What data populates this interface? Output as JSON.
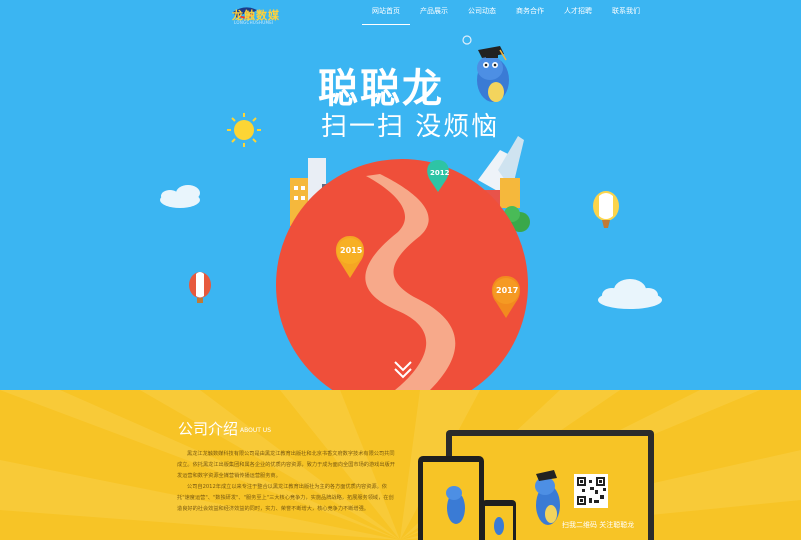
{
  "logo": {
    "name": "龙触数媒",
    "sub": "LONGCHUSHUMEI"
  },
  "nav": {
    "items": [
      {
        "label": "网站首页",
        "active": true
      },
      {
        "label": "产品展示",
        "active": false
      },
      {
        "label": "公司动态",
        "active": false
      },
      {
        "label": "商务合作",
        "active": false
      },
      {
        "label": "人才招聘",
        "active": false
      },
      {
        "label": "联系我们",
        "active": false
      }
    ]
  },
  "hero": {
    "title": "聪聪龙",
    "subtitle": "扫一扫 没烦恼",
    "markers": [
      {
        "year": "2012",
        "color": "#2ec4a5"
      },
      {
        "year": "2015",
        "color": "#f5a623"
      },
      {
        "year": "2017",
        "color": "#f28b1e"
      }
    ],
    "scroll_icon": "chevron-down-icon"
  },
  "about": {
    "title": "公司介绍",
    "title_en": "ABOUT US",
    "paragraphs": [
      "黑龙江龙触数媒科技有限公司是由黑龙江教育出版社和北京书香文府数字技术有限公司共同成立。依托黑龙江出版集团和属各企业的优质内容资源，致力于成为面向全国市场的游戏出版开发运营和数字资源全媒营销传播运营服务商。",
      "公司自2012年成立以来专注于整合以黑龙江教育出版社为主的各方面优质内容资源。依托\"速度运营\"、\"数独研发\"、\"服务至上\"三大核心竞争力，实施品牌战略，拓展服务领域，在创造良好的社会效益和经济效益的同时，实力、荣誉不断增大，核心竞争力不断增强。"
    ]
  },
  "devices": {
    "slogan": "扫我二维码  关注聪聪龙"
  },
  "colors": {
    "sky": "#3bb5f2",
    "planet": "#f1503a",
    "road": "#f7a98a",
    "yellow": "#f7c426"
  }
}
